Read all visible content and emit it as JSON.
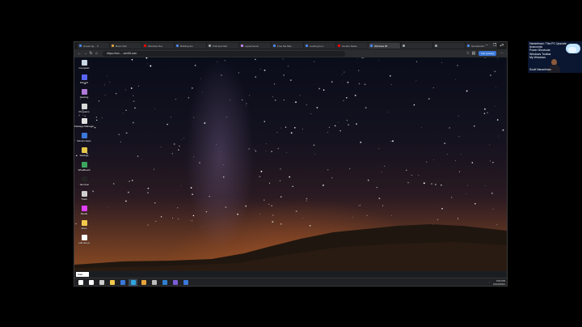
{
  "browser": {
    "tabs": [
      {
        "label": "streaming... ✕",
        "color": "#4a8af4",
        "active": false
      },
      {
        "label": "Book Club",
        "color": "#e8a33b",
        "active": false
      },
      {
        "label": "Windows Nos",
        "color": "#ff0000",
        "active": false
      },
      {
        "label": "Building the",
        "color": "#4a8af4",
        "active": false
      },
      {
        "label": "OVA and NGI",
        "color": "#9aa0a6",
        "active": false
      },
      {
        "label": "experimenta",
        "color": "#c58af9",
        "active": false
      },
      {
        "label": "Free Me Mas",
        "color": "#4a8af4",
        "active": false
      },
      {
        "label": "Looking for a",
        "color": "#4a8af4",
        "active": false
      },
      {
        "label": "Gender Dekte",
        "color": "#ff0000",
        "active": false
      },
      {
        "label": "Windows 95",
        "color": "#4a8af4",
        "active": true
      },
      {
        "label": "",
        "color": "#9aa0a6",
        "active": false
      },
      {
        "label": "",
        "color": "#9aa0a6",
        "active": false
      },
      {
        "label": "Namelesshc",
        "color": "#4a8af4",
        "active": false
      }
    ],
    "new_tab": "+",
    "window_controls": {
      "minimize": "–",
      "maximize": "❐",
      "close": "✕"
    },
    "nav": {
      "back": "←",
      "forward": "→",
      "reload": "↻",
      "home": "⌂"
    },
    "url": "https://win.... win96.com",
    "signin_label": "Not syncing",
    "menu": "⋯"
  },
  "desktop": {
    "icons": [
      {
        "label": "Computer",
        "color": "#c9d6e3"
      },
      {
        "label": "Discord",
        "color": "#5865f2"
      },
      {
        "label": "Gaming",
        "color": "#b07ad8"
      },
      {
        "label": "Programs",
        "color": "#d8d8d8"
      },
      {
        "label": "Package Manager",
        "color": "#e0e0e0"
      },
      {
        "label": "Recent Apps",
        "color": "#3b78d8"
      },
      {
        "label": "Settings",
        "color": "#e6c84a"
      },
      {
        "label": "WineBoard",
        "color": "#3ba55d"
      },
      {
        "label": "Terminal",
        "color": "#222222"
      },
      {
        "label": "Trash",
        "color": "#cfcfcf"
      },
      {
        "label": "Media",
        "color": "#e040fb"
      },
      {
        "label": "Docs",
        "color": "#f2c94c"
      },
      {
        "label": "edit.doc.js",
        "color": "#ffffff"
      }
    ],
    "watermark": "Photo by ..."
  },
  "taskbar": {
    "start_label": "Start",
    "pinned": [
      {
        "name": "start-icon",
        "color": "#ffffff"
      },
      {
        "name": "search-icon",
        "color": "#ffffff"
      },
      {
        "name": "task-view-icon",
        "color": "#cccccc"
      },
      {
        "name": "explorer-icon",
        "color": "#f2c94c"
      },
      {
        "name": "store-icon",
        "color": "#3b78d8"
      },
      {
        "name": "edge-icon",
        "color": "#2fa5e0"
      },
      {
        "name": "chrome-icon",
        "color": "#e8a33b"
      },
      {
        "name": "terminal-icon",
        "color": "#bbbbbb"
      },
      {
        "name": "vscode-icon",
        "color": "#2f7fd0"
      },
      {
        "name": "teams-icon",
        "color": "#7b5cd6"
      },
      {
        "name": "app-icon",
        "color": "#3b78d8"
      }
    ],
    "tray_time": "3:52 PM",
    "tray_date": "10/22/2021"
  },
  "webcam": {
    "lines": [
      "Hanselman: This PC Upscale",
      "Anaconda",
      "Power Shortcuts",
      "Windows Toolbar",
      "My Windows"
    ],
    "name": "Scott Hanselman"
  }
}
